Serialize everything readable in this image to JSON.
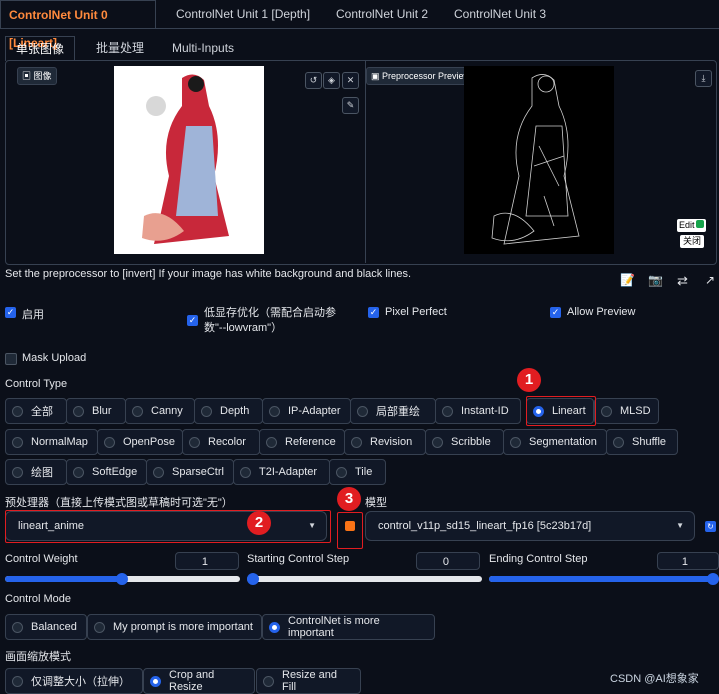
{
  "unit_tabs": [
    "ControlNet Unit 0 [Lineart]",
    "ControlNet Unit 1 [Depth]",
    "ControlNet Unit 2",
    "ControlNet Unit 3"
  ],
  "input_tabs": [
    "单张图像",
    "批量处理",
    "Multi-Inputs"
  ],
  "image_panel": {
    "label": "图像"
  },
  "preview_panel": {
    "label": "Preprocessor Preview",
    "edit_label": "Edit",
    "close_label": "关闭"
  },
  "hint": "Set the preprocessor to [invert] If your image has white background and black lines.",
  "options": {
    "enable": "启用",
    "low_vram": "低显存优化（需配合启动参数\"--lowvram\"）",
    "pixel_perfect": "Pixel Perfect",
    "allow_preview": "Allow Preview",
    "mask_upload": "Mask Upload"
  },
  "control_type": {
    "label": "Control Type",
    "selected": "Lineart",
    "rows": [
      [
        "全部",
        "Blur",
        "Canny",
        "Depth",
        "IP-Adapter",
        "局部重绘",
        "Instant-ID",
        "Lineart",
        "MLSD"
      ],
      [
        "NormalMap",
        "OpenPose",
        "Recolor",
        "Reference",
        "Revision",
        "Scribble",
        "Segmentation",
        "Shuffle"
      ],
      [
        "绘图",
        "SoftEdge",
        "SparseCtrl",
        "T2I-Adapter",
        "Tile"
      ]
    ]
  },
  "preprocessor": {
    "label": "预处理器（直接上传模式图或草稿时可选\"无\"）",
    "value": "lineart_anime"
  },
  "model": {
    "label": "模型",
    "value": "control_v11p_sd15_lineart_fp16 [5c23b17d]"
  },
  "weights": {
    "control_weight": {
      "label": "Control Weight",
      "value": "1",
      "level": 0.5
    },
    "starting_step": {
      "label": "Starting Control Step",
      "value": "0",
      "level": 0.0
    },
    "ending_step": {
      "label": "Ending Control Step",
      "value": "1",
      "level": 1.0
    }
  },
  "control_mode": {
    "label": "Control Mode",
    "items": [
      "Balanced",
      "My prompt is more important",
      "ControlNet is more important"
    ],
    "selected": "ControlNet is more important"
  },
  "resize_mode": {
    "label": "画面缩放模式",
    "items": [
      "仅调整大小（拉伸）",
      "Crop and Resize",
      "Resize and Fill"
    ],
    "selected": "Crop and Resize"
  },
  "annotations": [
    "1",
    "2",
    "3"
  ],
  "watermark": "CSDN @AI想象家",
  "colors": {
    "accent": "#ff8a3d",
    "primary": "#2563eb",
    "highlight": "#e11d21",
    "background": "#0b0f19"
  }
}
